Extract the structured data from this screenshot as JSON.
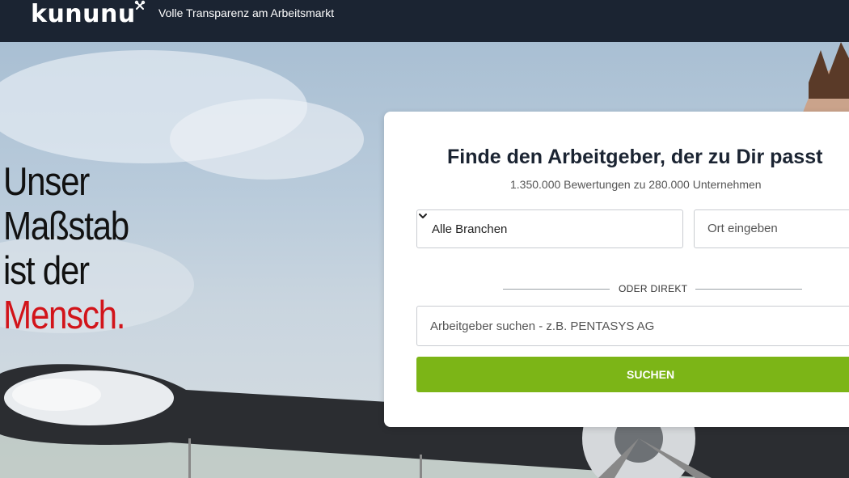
{
  "header": {
    "logo_text": "kununu",
    "tagline": "Volle Transparenz am Arbeitsmarkt"
  },
  "hero": {
    "headline": [
      "Unser",
      "Maßstab",
      "ist der"
    ],
    "headline_accent": "Mensch."
  },
  "search_card": {
    "title": "Finde den Arbeitgeber, der zu Dir passt",
    "subtitle": "1.350.000 Bewertungen zu 280.000 Unternehmen",
    "industry_select": {
      "selected": "Alle Branchen"
    },
    "location_input": {
      "placeholder": "Ort eingeben",
      "value": ""
    },
    "divider_text": "ODER DIREKT",
    "employer_input": {
      "placeholder": "Arbeitgeber suchen - z.B. PENTASYS AG",
      "value": ""
    },
    "submit_label": "SUCHEN"
  },
  "colors": {
    "header_bg": "#1b2432",
    "accent_green": "#7cb517",
    "accent_red": "#d2141a"
  },
  "icons": [
    "kununu-mark-icon",
    "chevron-down-icon"
  ]
}
